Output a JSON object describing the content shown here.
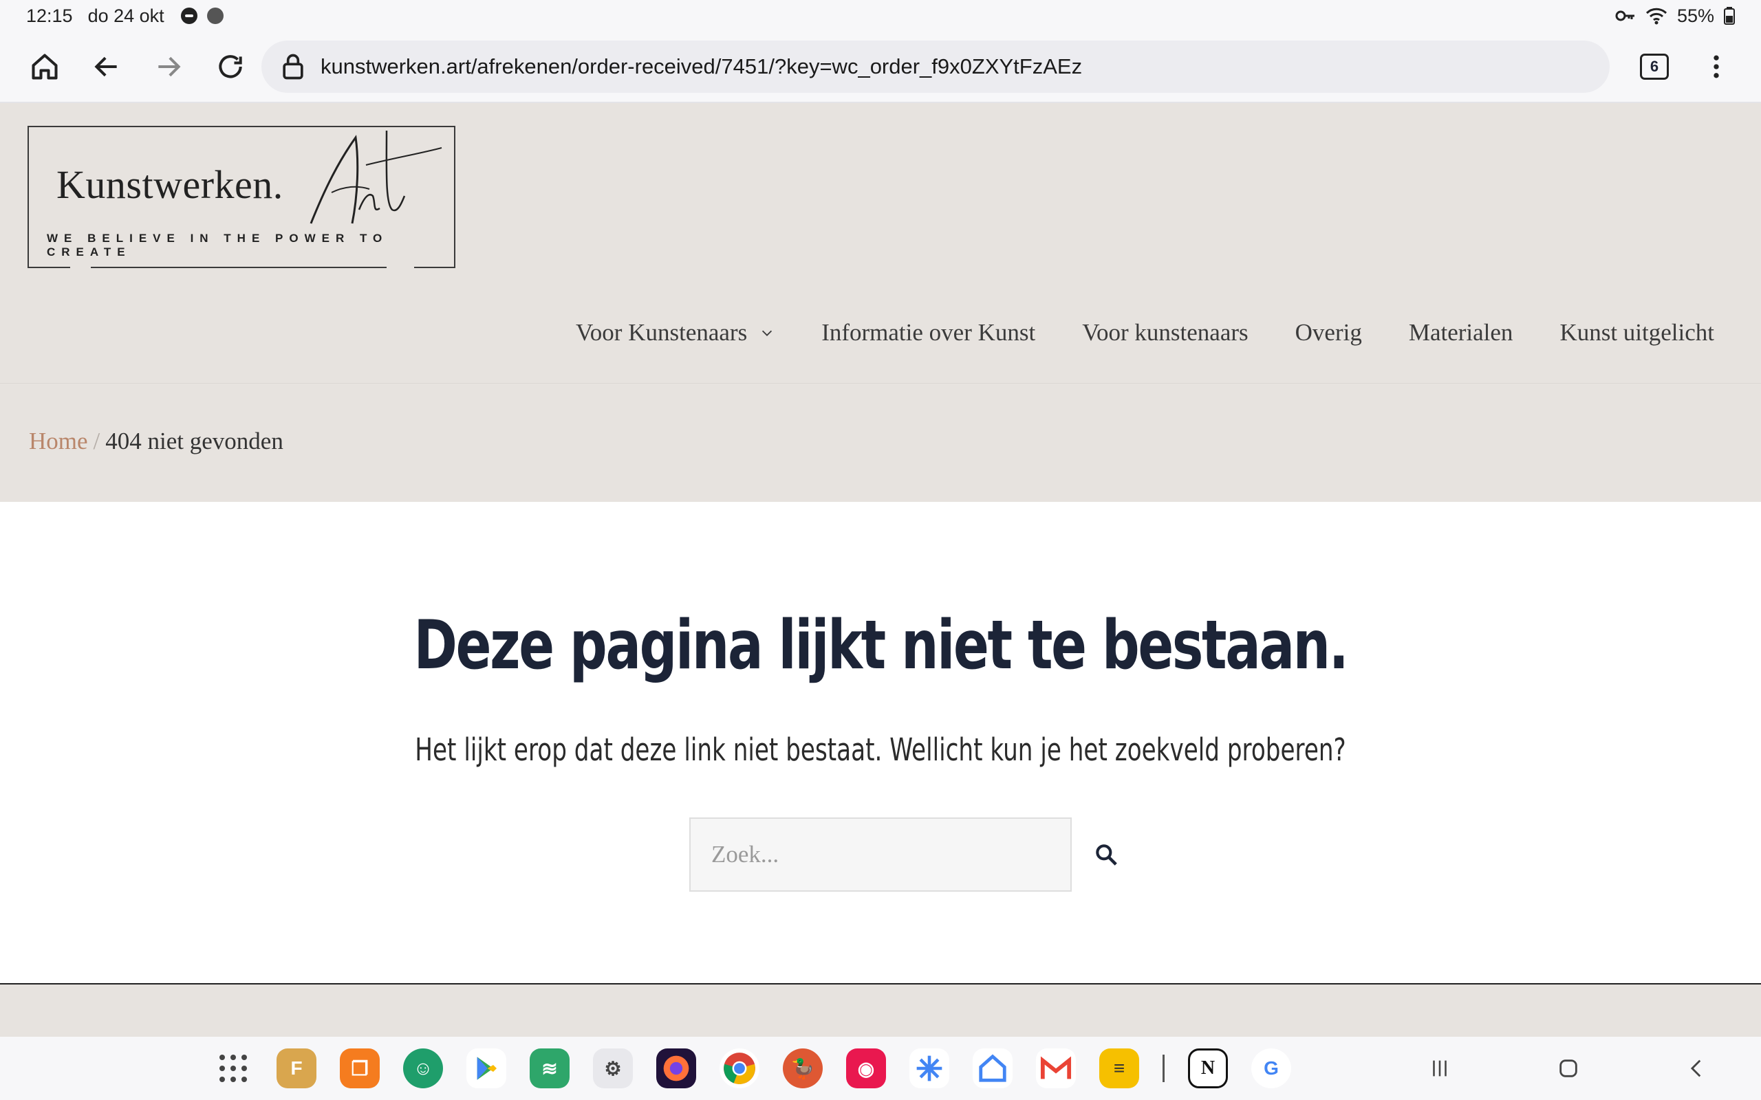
{
  "status": {
    "time": "12:15",
    "date": "do 24 okt",
    "battery": "55%"
  },
  "browser": {
    "url": "kunstwerken.art/afrekenen/order-received/7451/?key=wc_order_f9x0ZXYtFzAEz",
    "tab_count": "6"
  },
  "logo": {
    "main": "Kunstwerken.",
    "script": "Art",
    "tagline": "WE BELIEVE IN THE POWER TO CREATE"
  },
  "nav": {
    "items": [
      {
        "label": "Voor Kunstenaars",
        "has_dropdown": true
      },
      {
        "label": "Informatie over Kunst"
      },
      {
        "label": "Voor kunstenaars"
      },
      {
        "label": "Overig"
      },
      {
        "label": "Materialen"
      },
      {
        "label": "Kunst uitgelicht"
      }
    ]
  },
  "breadcrumb": {
    "home": "Home",
    "separator": "/",
    "current": "404 niet gevonden"
  },
  "error": {
    "title": "Deze pagina lijkt niet te bestaan.",
    "message": "Het lijkt erop dat deze link niet bestaat. Wellicht kun je het zoekveld proberen?"
  },
  "search": {
    "placeholder": "Zoek..."
  },
  "colors": {
    "header_bg": "#e7e3df",
    "title": "#1c2437",
    "link_accent": "#b9866a"
  },
  "taskbar": {
    "apps": [
      "app-drawer",
      "files",
      "multi-window",
      "maps-contacts",
      "play-store",
      "bank",
      "toolbox",
      "firefox",
      "chrome",
      "duckduckgo",
      "camera",
      "sparkle",
      "home",
      "gmail",
      "notes",
      "notion",
      "google"
    ]
  }
}
